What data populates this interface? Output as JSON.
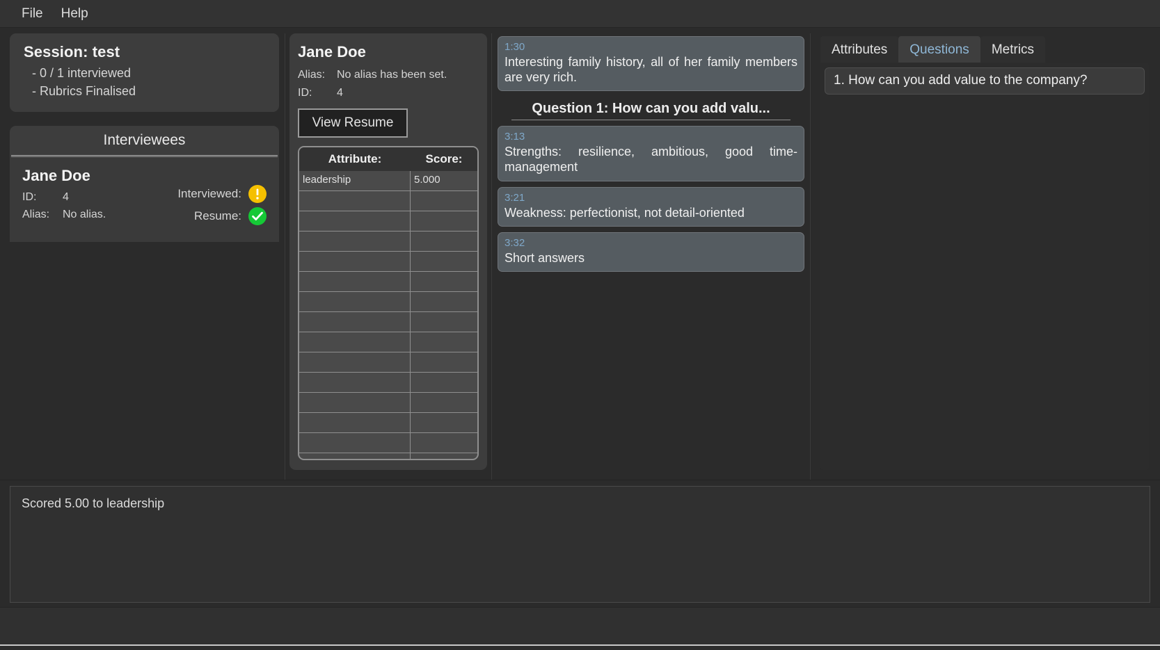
{
  "menubar": {
    "items": [
      {
        "label": "File"
      },
      {
        "label": "Help"
      }
    ]
  },
  "session": {
    "title": "Session: test",
    "line1": "- 0 / 1 interviewed",
    "line2": "- Rubrics Finalised"
  },
  "interviewees": {
    "header": "Interviewees",
    "list": [
      {
        "name": "Jane Doe",
        "id_label": "ID:",
        "id_value": "4",
        "alias_label": "Alias:",
        "alias_value": "No alias.",
        "interviewed_label": "Interviewed:",
        "interviewed_icon": "warning-circle-icon",
        "resume_label": "Resume:",
        "resume_icon": "check-circle-icon"
      }
    ]
  },
  "detail": {
    "name": "Jane Doe",
    "alias_label": "Alias:",
    "alias_value": "No alias has been set.",
    "id_label": "ID:",
    "id_value": "4",
    "view_resume_label": "View Resume",
    "table": {
      "columns": [
        "Attribute:",
        "Score:"
      ],
      "rows": [
        {
          "attribute": "leadership",
          "score": "5.000"
        },
        {
          "attribute": "",
          "score": ""
        },
        {
          "attribute": "",
          "score": ""
        },
        {
          "attribute": "",
          "score": ""
        },
        {
          "attribute": "",
          "score": ""
        },
        {
          "attribute": "",
          "score": ""
        },
        {
          "attribute": "",
          "score": ""
        },
        {
          "attribute": "",
          "score": ""
        },
        {
          "attribute": "",
          "score": ""
        },
        {
          "attribute": "",
          "score": ""
        },
        {
          "attribute": "",
          "score": ""
        },
        {
          "attribute": "",
          "score": ""
        },
        {
          "attribute": "",
          "score": ""
        },
        {
          "attribute": "",
          "score": ""
        },
        {
          "attribute": "",
          "score": ""
        }
      ]
    }
  },
  "transcript": {
    "entries_before": [
      {
        "time": "1:30",
        "text": "Interesting family history, all of her family members are very rich."
      }
    ],
    "question_header": "Question 1: How can you add valu...",
    "entries_after": [
      {
        "time": "3:13",
        "text": "Strengths: resilience, ambitious, good time-management"
      },
      {
        "time": "3:21",
        "text": "Weakness: perfectionist, not detail-oriented"
      },
      {
        "time": "3:32",
        "text": "Short answers"
      }
    ]
  },
  "right_panel": {
    "tabs": [
      {
        "label": "Attributes",
        "active": false
      },
      {
        "label": "Questions",
        "active": true
      },
      {
        "label": "Metrics",
        "active": false
      }
    ],
    "questions": [
      {
        "label": "1. How can you add value to the company?"
      }
    ]
  },
  "log": {
    "line": "Scored 5.00 to leadership"
  },
  "colors": {
    "accent_blue": "#8fb7d6",
    "timestamp_blue": "#7fa8c9",
    "warning_yellow": "#f5c000",
    "success_green": "#15c936",
    "panel_bg": "#3d3d3d",
    "window_bg": "#2b2b2b"
  }
}
